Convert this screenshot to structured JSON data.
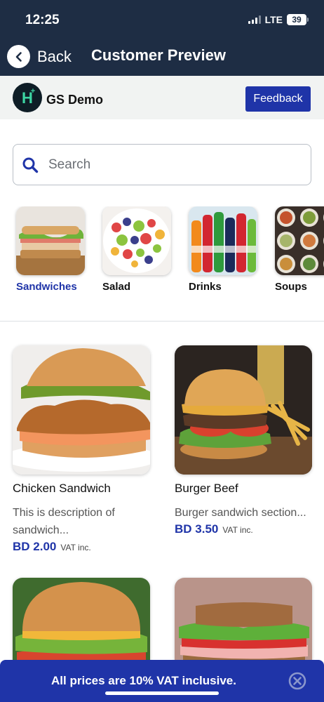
{
  "status_bar": {
    "time": "12:25",
    "network": "LTE",
    "battery": "39"
  },
  "header": {
    "back_label": "Back",
    "title": "Customer Preview"
  },
  "brand": {
    "name": "GS Demo",
    "logo_letter": "H",
    "feedback_label": "Feedback"
  },
  "search": {
    "placeholder": "Search"
  },
  "categories": [
    {
      "label": "Sandwiches",
      "active": true,
      "icon": "sandwich-thumbnail"
    },
    {
      "label": "Salad",
      "active": false,
      "icon": "salad-thumbnail"
    },
    {
      "label": "Drinks",
      "active": false,
      "icon": "drinks-thumbnail"
    },
    {
      "label": "Soups",
      "active": false,
      "icon": "soups-thumbnail"
    }
  ],
  "products": [
    {
      "name": "Chicken Sandwich",
      "description": "This is description of sandwich...",
      "price": "BD 2.00",
      "vat": "VAT inc.",
      "icon": "chicken-sandwich-photo"
    },
    {
      "name": "Burger Beef",
      "description": "Burger sandwich section...",
      "price": "BD 3.50",
      "vat": "VAT inc.",
      "icon": "beef-burger-photo"
    },
    {
      "name": "",
      "description": "",
      "price": "",
      "vat": "",
      "icon": "burger-photo"
    },
    {
      "name": "",
      "description": "",
      "price": "",
      "vat": "",
      "icon": "ham-sandwich-photo"
    }
  ],
  "banner": {
    "text": "All prices are 10% VAT inclusive."
  },
  "colors": {
    "header_bg": "#1e2d44",
    "accent": "#1f34a8",
    "brand_row_bg": "#f1f3f2"
  }
}
